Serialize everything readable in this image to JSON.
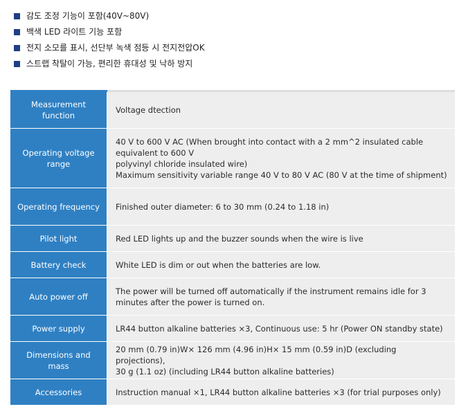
{
  "features": [
    "감도 조정 기능이 포함(40V~80V)",
    "백색 LED 라이트 기능 포함",
    "전지 소모를 표시, 선단부 녹색 점등 시 전지전압OK",
    "스트랩 착탈이 가능, 편리한 휴대성 및 낙하 방지"
  ],
  "specs": [
    {
      "label": "Measurement function",
      "value": [
        "Voltage dtection"
      ]
    },
    {
      "label": "Operating voltage range",
      "value": [
        "40 V to 600 V AC (When brought into contact with a 2 mm^2 insulated cable equivalent to 600 V",
        "polyvinyl chloride insulated wire)",
        "Maximum sensitivity variable range 40 V to 80 V AC (80 V at the time of shipment)"
      ]
    },
    {
      "label": "Operating frequency",
      "value": [
        "Finished outer diameter: 6 to 30 mm (0.24 to 1.18 in)"
      ]
    },
    {
      "label": "Pilot light",
      "value": [
        "Red LED lights up and the buzzer sounds when the wire is live"
      ]
    },
    {
      "label": "Battery check",
      "value": [
        "White LED is dim or out when the batteries are low."
      ]
    },
    {
      "label": "Auto power off",
      "value": [
        "The power will be turned off automatically if the instrument remains idle for 3 minutes after the power is turned on."
      ]
    },
    {
      "label": "Power supply",
      "value": [
        "LR44 button alkaline batteries ×3, Continuous use: 5 hr (Power ON standby state)"
      ]
    },
    {
      "label": "Dimensions and mass",
      "value": [
        "20 mm (0.79 in)W× 126 mm (4.96 in)H× 15 mm (0.59 in)D (excluding projections),",
        "30 g (1.1 oz) (including LR44 button alkaline batteries)"
      ]
    },
    {
      "label": "Accessories",
      "value": [
        "Instruction manual ×1, LR44 button alkaline batteries ×3 (for trial purposes only)"
      ]
    }
  ],
  "colors": {
    "bullet": "#1f3f86",
    "label_bg": "#2f80c3",
    "value_bg": "#eeeeee"
  }
}
